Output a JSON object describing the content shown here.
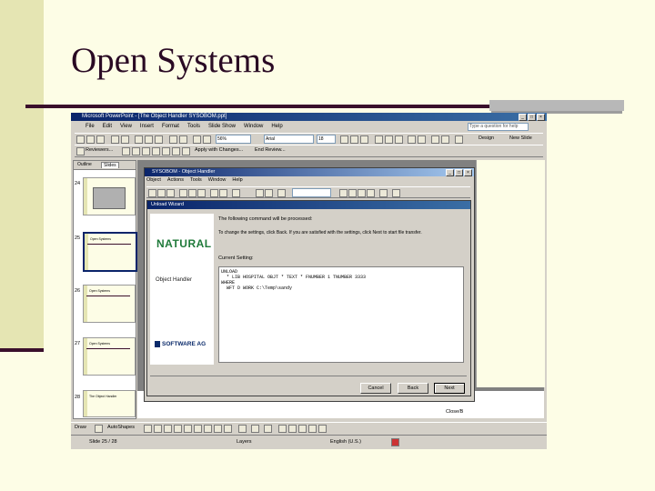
{
  "slide": {
    "title": "Open Systems"
  },
  "window": {
    "title": "Microsoft PowerPoint - [The Object Handler SYSOBOM.ppt]",
    "menu": [
      "File",
      "Edit",
      "View",
      "Insert",
      "Format",
      "Tools",
      "Slide Show",
      "Window",
      "Help"
    ],
    "help_placeholder": "Type a question for help",
    "zoom": "56%",
    "font": "Arial",
    "font_size": "18",
    "design_label": "Design",
    "new_slide_label": "New Slide",
    "reviewers_label": "Reviewers...",
    "apply_label": "Apply with Changes...",
    "end_review_label": "End Review..."
  },
  "panel": {
    "tabs": [
      "Outline",
      "Slides"
    ],
    "slides": [
      {
        "num": "24",
        "title": ""
      },
      {
        "num": "25",
        "title": "Open Systems"
      },
      {
        "num": "26",
        "title": "Open Systems"
      },
      {
        "num": "27",
        "title": "Open Systems"
      },
      {
        "num": "28",
        "title": "The Object Handler"
      }
    ]
  },
  "sysobom": {
    "title": "SYSOBOM - Object Handler",
    "menu": [
      "Object",
      "Actions",
      "Tools",
      "Window",
      "Help"
    ]
  },
  "wizard": {
    "title": "Unload Wizard",
    "logo_natural": "NATURAL",
    "object_handler_label": "Object Handler",
    "sag_logo": "SOFTWARE AG",
    "intro": "The following command will be processed:",
    "instruction": "To change the settings, click Back. If you are satisfied with the settings, click Next to start file transfer.",
    "current_setting_label": "Current Setting:",
    "command_lines": [
      "UNLOAD",
      "  * LIB HOSPITAL OBJT * TEXT * FNUMBER 1 TNUMBER 3333",
      "WHERE",
      "  WFT D WORK C:\\Temp\\sandy"
    ],
    "buttons": {
      "cancel": "Cancel",
      "back": "Back",
      "next": "Next"
    }
  },
  "status": {
    "slide_of": "Slide 25 / 28",
    "design": "Layers",
    "language": "English (U.S.)",
    "small": "Close/B"
  },
  "draw": {
    "draw_label": "Draw",
    "autoshapes_label": "AutoShapes"
  }
}
